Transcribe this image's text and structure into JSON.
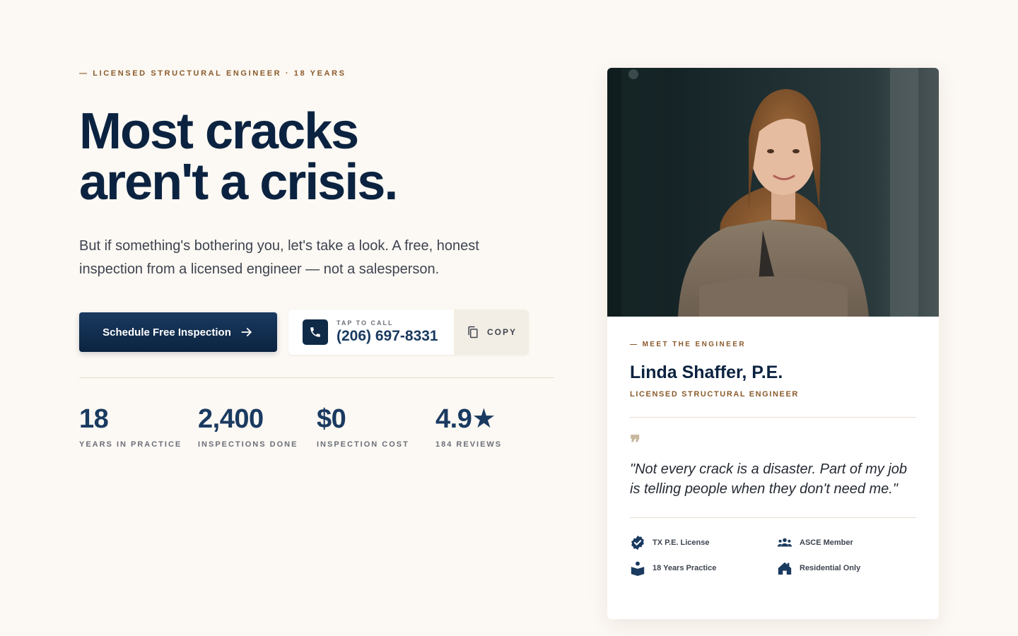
{
  "hero": {
    "eyebrow": "— LICENSED STRUCTURAL ENGINEER · 18 YEARS",
    "headline_line1": "Most cracks",
    "headline_line2": "aren't a crisis.",
    "lede": "But if something's bothering you, let's take a look. A free, honest inspection from a licensed engineer — not a salesperson.",
    "primary_button": "Schedule Free Inspection",
    "phone_label": "TAP TO CALL",
    "phone_number": "(206) 697-8331",
    "copy_label": "COPY"
  },
  "stats": [
    {
      "value": "18",
      "label": "YEARS IN PRACTICE"
    },
    {
      "value": "2,400",
      "label": "INSPECTIONS DONE"
    },
    {
      "value": "$0",
      "label": "INSPECTION COST"
    },
    {
      "value": "4.9★",
      "label": "184 REVIEWS"
    }
  ],
  "card": {
    "eyebrow": "— MEET THE ENGINEER",
    "name": "Linda Shaffer, P.E.",
    "title": "LICENSED STRUCTURAL ENGINEER",
    "quote_mark": "❞",
    "quote": "\"Not every crack is a disaster. Part of my job is telling people when they don't need me.\"",
    "badges": [
      {
        "icon": "verified-badge-icon",
        "label": "TX P.E. License"
      },
      {
        "icon": "people-group-icon",
        "label": "ASCE Member"
      },
      {
        "icon": "book-reader-icon",
        "label": "18 Years Practice"
      },
      {
        "icon": "house-icon",
        "label": "Residential Only"
      }
    ]
  },
  "colors": {
    "background": "#fcf8f3",
    "navy": "#0b2340",
    "accent_brown": "#8a5a2b",
    "card": "#ffffff"
  }
}
